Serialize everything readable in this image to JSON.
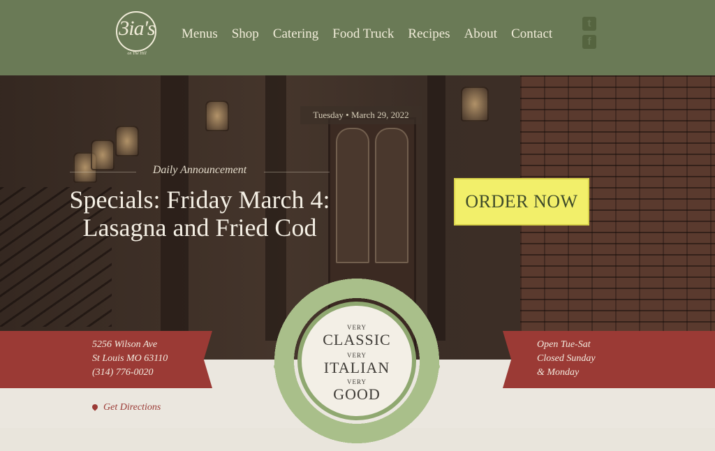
{
  "header": {
    "logo_text": "3ia's",
    "logo_sub": "on The Hill",
    "nav": [
      "Menus",
      "Shop",
      "Catering",
      "Food Truck",
      "Recipes",
      "About",
      "Contact"
    ],
    "social": [
      {
        "icon": "twitter-icon",
        "glyph": "t"
      },
      {
        "icon": "facebook-icon",
        "glyph": "f"
      }
    ]
  },
  "hero": {
    "date": "Tuesday • March 29, 2022",
    "announcement_label": "Daily Announcement",
    "headline": "Specials: Friday March 4: Lasagna and Fried Cod",
    "order_button": "ORDER NOW"
  },
  "location": {
    "address_line1": "5256 Wilson Ave",
    "address_line2": "St Louis MO 63110",
    "phone": "(314) 776-0020",
    "directions": "Get Directions"
  },
  "hours": {
    "line1": "Open Tue-Sat",
    "line2": "Closed Sunday",
    "line3": "& Monday"
  },
  "emblem": {
    "very": "VERY",
    "word1": "CLASSIC",
    "word2": "ITALIAN",
    "word3": "GOOD"
  },
  "colors": {
    "header_green": "#6a7a56",
    "banner_red": "#9b3a35",
    "order_yellow": "#f2ef6a",
    "wreath_green": "#a9bf8a"
  }
}
